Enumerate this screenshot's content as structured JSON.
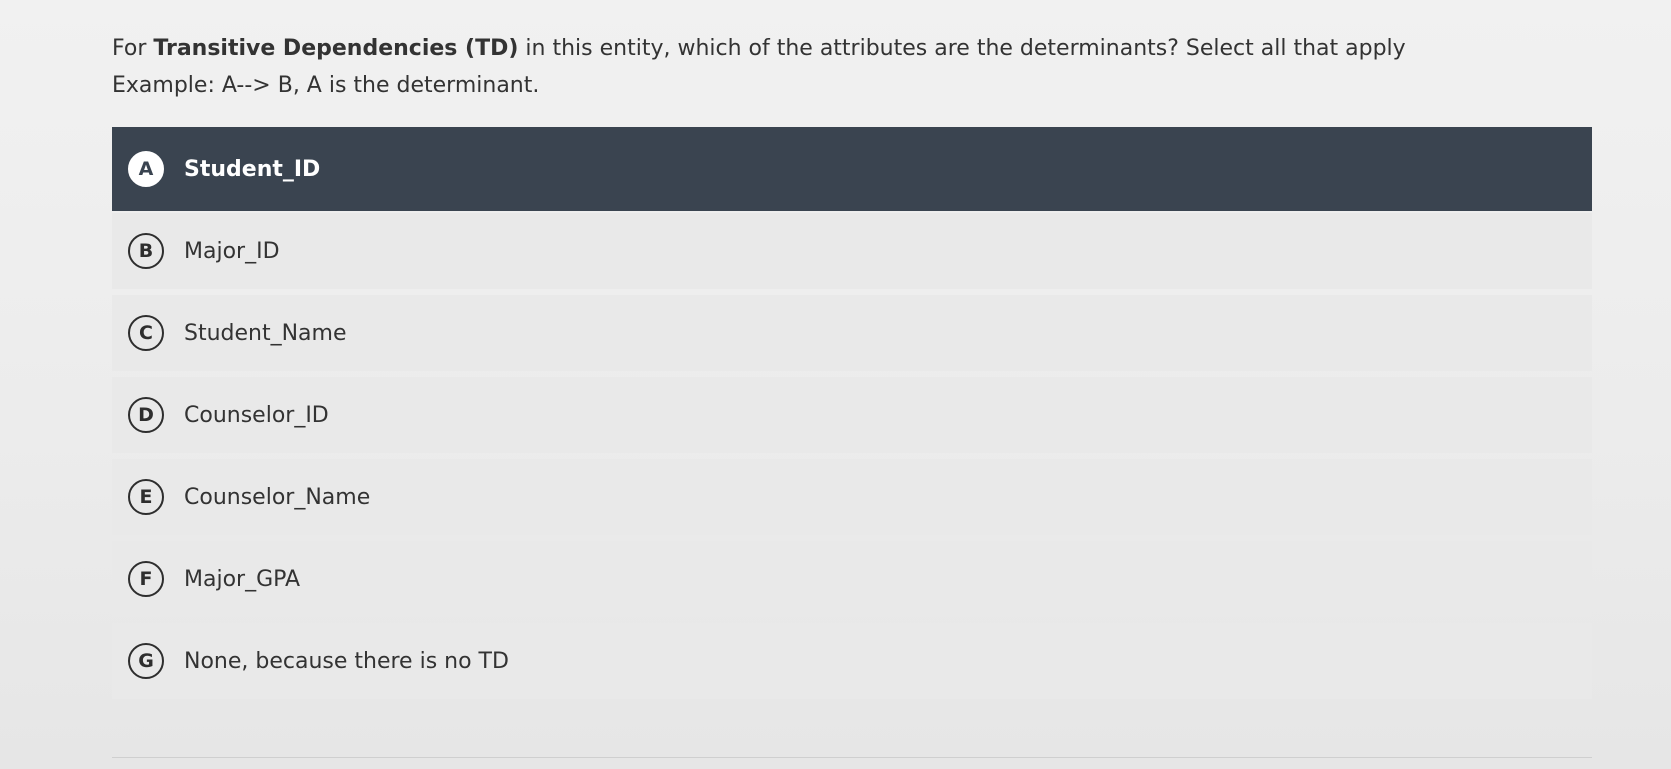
{
  "question": {
    "prefix": "For ",
    "bold": "Transitive Dependencies (TD)",
    "suffix": " in this entity, which of the attributes are the determinants? Select all that apply",
    "example": "Example: A--> B, A is the determinant."
  },
  "options": [
    {
      "letter": "A",
      "label": "Student_ID",
      "selected": true
    },
    {
      "letter": "B",
      "label": "Major_ID",
      "selected": false
    },
    {
      "letter": "C",
      "label": "Student_Name",
      "selected": false
    },
    {
      "letter": "D",
      "label": "Counselor_ID",
      "selected": false
    },
    {
      "letter": "E",
      "label": "Counselor_Name",
      "selected": false
    },
    {
      "letter": "F",
      "label": "Major_GPA",
      "selected": false
    },
    {
      "letter": "G",
      "label": "None, because there is no TD",
      "selected": false
    }
  ],
  "colors": {
    "selected_background": "#3a4450",
    "option_background": "#e9e9e9",
    "page_background": "#efefef"
  }
}
